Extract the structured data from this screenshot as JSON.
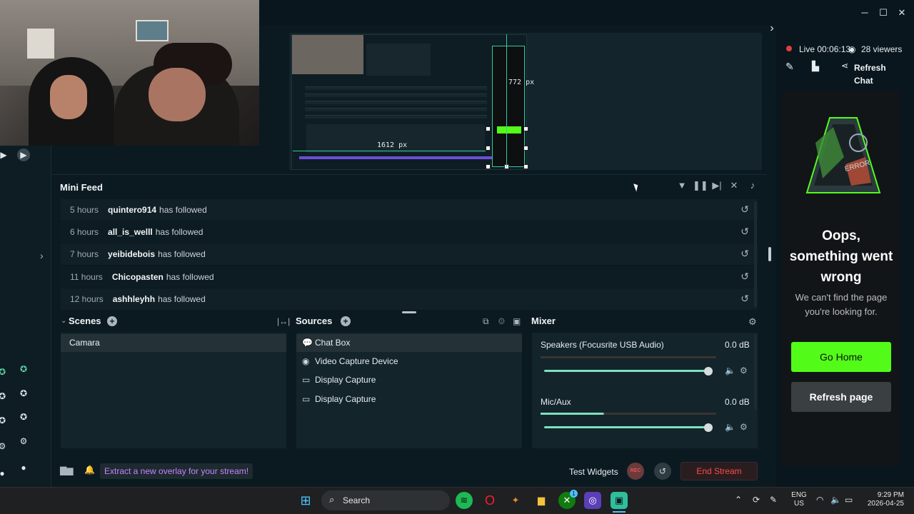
{
  "window": {
    "minimize_glyph": "─",
    "maximize_glyph": "☐",
    "close_glyph": "✕",
    "collapse_glyph": "›"
  },
  "preview": {
    "height_label": "772 px",
    "width_label": "1612 px"
  },
  "mini_feed": {
    "title": "Mini Feed",
    "items": [
      {
        "time": "5 hours",
        "user": "quintero914",
        "action": "has followed"
      },
      {
        "time": "6 hours",
        "user": "all_is_welll",
        "action": "has followed"
      },
      {
        "time": "7 hours",
        "user": "yeibidebois",
        "action": "has followed"
      },
      {
        "time": "11 hours",
        "user": "Chicopasten",
        "action": "has followed"
      },
      {
        "time": "12 hours",
        "user": "ashhleyhh",
        "action": "has followed"
      }
    ]
  },
  "scenes": {
    "title": "Scenes",
    "items": [
      "Camara"
    ]
  },
  "sources": {
    "title": "Sources",
    "items": [
      {
        "label": "Chat Box",
        "icon": "chat-icon"
      },
      {
        "label": "Video Capture Device",
        "icon": "webcam-icon"
      },
      {
        "label": "Display Capture",
        "icon": "monitor-icon"
      },
      {
        "label": "Display Capture",
        "icon": "monitor-icon"
      }
    ]
  },
  "mixer": {
    "title": "Mixer",
    "channels": [
      {
        "name": "Speakers (Focusrite USB Audio)",
        "db": "0.0 dB",
        "volume": 1.0
      },
      {
        "name": "Mic/Aux",
        "db": "0.0 dB",
        "volume": 1.0
      }
    ]
  },
  "bottom_bar": {
    "promo": "Extract a new overlay for your stream!",
    "test_widgets": "Test Widgets",
    "rec": "REC",
    "end_stream": "End Stream"
  },
  "chat": {
    "live_label": "Live",
    "live_time": "00:06:13",
    "viewers": "28 viewers",
    "refresh_chat": "Refresh Chat",
    "error_title": "Oops, something went wrong",
    "error_message": "We can't find the page you're looking for.",
    "go_home": "Go Home",
    "refresh_page": "Refresh page",
    "art_label": "ERROR"
  },
  "taskbar": {
    "search_placeholder": "Search",
    "language": "ENG",
    "region": "US",
    "time": "9:29 PM",
    "date": "2026-04-25",
    "badge": "1"
  },
  "colors": {
    "accent_green": "#53fc18",
    "end_stream_red": "#ff4b4b",
    "promo_purple": "#c883ff",
    "slider_teal": "#7fe0c0"
  }
}
